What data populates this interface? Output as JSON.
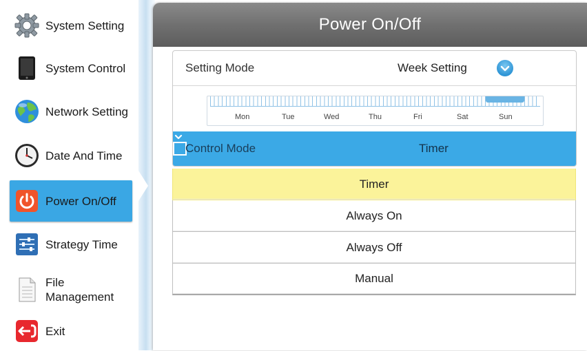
{
  "sidebar": {
    "items": [
      {
        "label": "System Setting",
        "icon": "gear-icon"
      },
      {
        "label": "System Control",
        "icon": "tablet-icon"
      },
      {
        "label": "Network Setting",
        "icon": "globe-icon"
      },
      {
        "label": "Date And Time",
        "icon": "clock-icon"
      },
      {
        "label": "Power On/Off",
        "icon": "power-icon",
        "active": true
      },
      {
        "label": "Strategy Time",
        "icon": "sliders-icon"
      },
      {
        "label": "File",
        "label2": "Management",
        "icon": "document-icon"
      },
      {
        "label": "Exit",
        "icon": "exit-icon"
      }
    ]
  },
  "header": {
    "title": "Power On/Off"
  },
  "setting_mode": {
    "label": "Setting Mode",
    "value": "Week Setting"
  },
  "timeline": {
    "days": [
      "Mon",
      "Tue",
      "Wed",
      "Thu",
      "Fri",
      "Sat",
      "Sun"
    ]
  },
  "control_mode": {
    "label": "Control Mode",
    "value": "Timer"
  },
  "options": [
    "Timer",
    "Always On",
    "Always Off",
    "Manual"
  ],
  "colors": {
    "accent": "#3ba9e6",
    "selected_option": "#fbf39a",
    "header": "#707070",
    "power_icon": "#f0542a",
    "exit_icon": "#e8282e"
  }
}
